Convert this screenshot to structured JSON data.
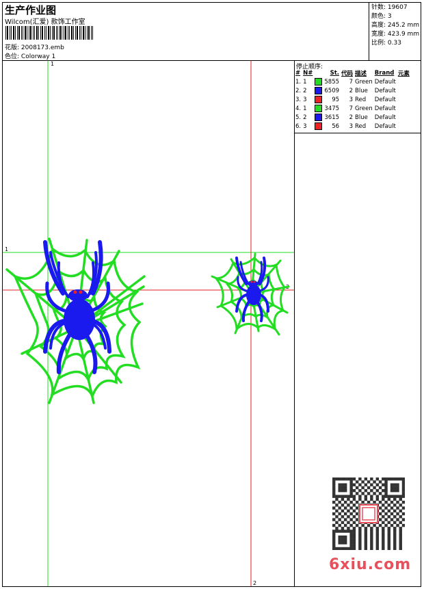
{
  "header": {
    "title": "生产作业图",
    "subtitle": "Wilcom(汇爱) 款饰工作室",
    "design_label": "花版:",
    "design_value": "2008173.emb",
    "colorway_label": "色位:",
    "colorway_value": "Colorway 1"
  },
  "stats": [
    {
      "label": "针数:",
      "value": "19607"
    },
    {
      "label": "颜色:",
      "value": "3"
    },
    {
      "label": "高度:",
      "value": "245.2 mm"
    },
    {
      "label": "宽度:",
      "value": "423.9 mm"
    },
    {
      "label": "比例:",
      "value": "0.33"
    }
  ],
  "stop_sequence": {
    "title": "停止顺序:",
    "columns": [
      "#",
      "N#",
      "St.",
      "代码",
      "描述",
      "Brand",
      "元素"
    ],
    "rows": [
      {
        "idx": "1.",
        "needle": "1",
        "color": "#22dd22",
        "stitches": "5855",
        "code": "7",
        "desc": "Green",
        "brand": "Default"
      },
      {
        "idx": "2.",
        "needle": "2",
        "color": "#1a1aee",
        "stitches": "6509",
        "code": "2",
        "desc": "Blue",
        "brand": "Default"
      },
      {
        "idx": "3.",
        "needle": "3",
        "color": "#ee2222",
        "stitches": "95",
        "code": "3",
        "desc": "Red",
        "brand": "Default"
      },
      {
        "idx": "4.",
        "needle": "1",
        "color": "#22dd22",
        "stitches": "3475",
        "code": "7",
        "desc": "Green",
        "brand": "Default"
      },
      {
        "idx": "5.",
        "needle": "2",
        "color": "#1a1aee",
        "stitches": "3615",
        "code": "2",
        "desc": "Blue",
        "brand": "Default"
      },
      {
        "idx": "6.",
        "needle": "3",
        "color": "#ee2222",
        "stitches": "56",
        "code": "3",
        "desc": "Red",
        "brand": "Default"
      }
    ]
  },
  "guides": {
    "green_v_label": "1",
    "green_h_label": "1",
    "red_h_label": "2",
    "red_v_label": "2"
  },
  "watermark": "6xiu.com",
  "colors": {
    "web": "#22dd22",
    "spider": "#1a1aee",
    "accent": "#ee2222",
    "guide_green": "#22dd22",
    "guide_red": "#dd2222"
  }
}
